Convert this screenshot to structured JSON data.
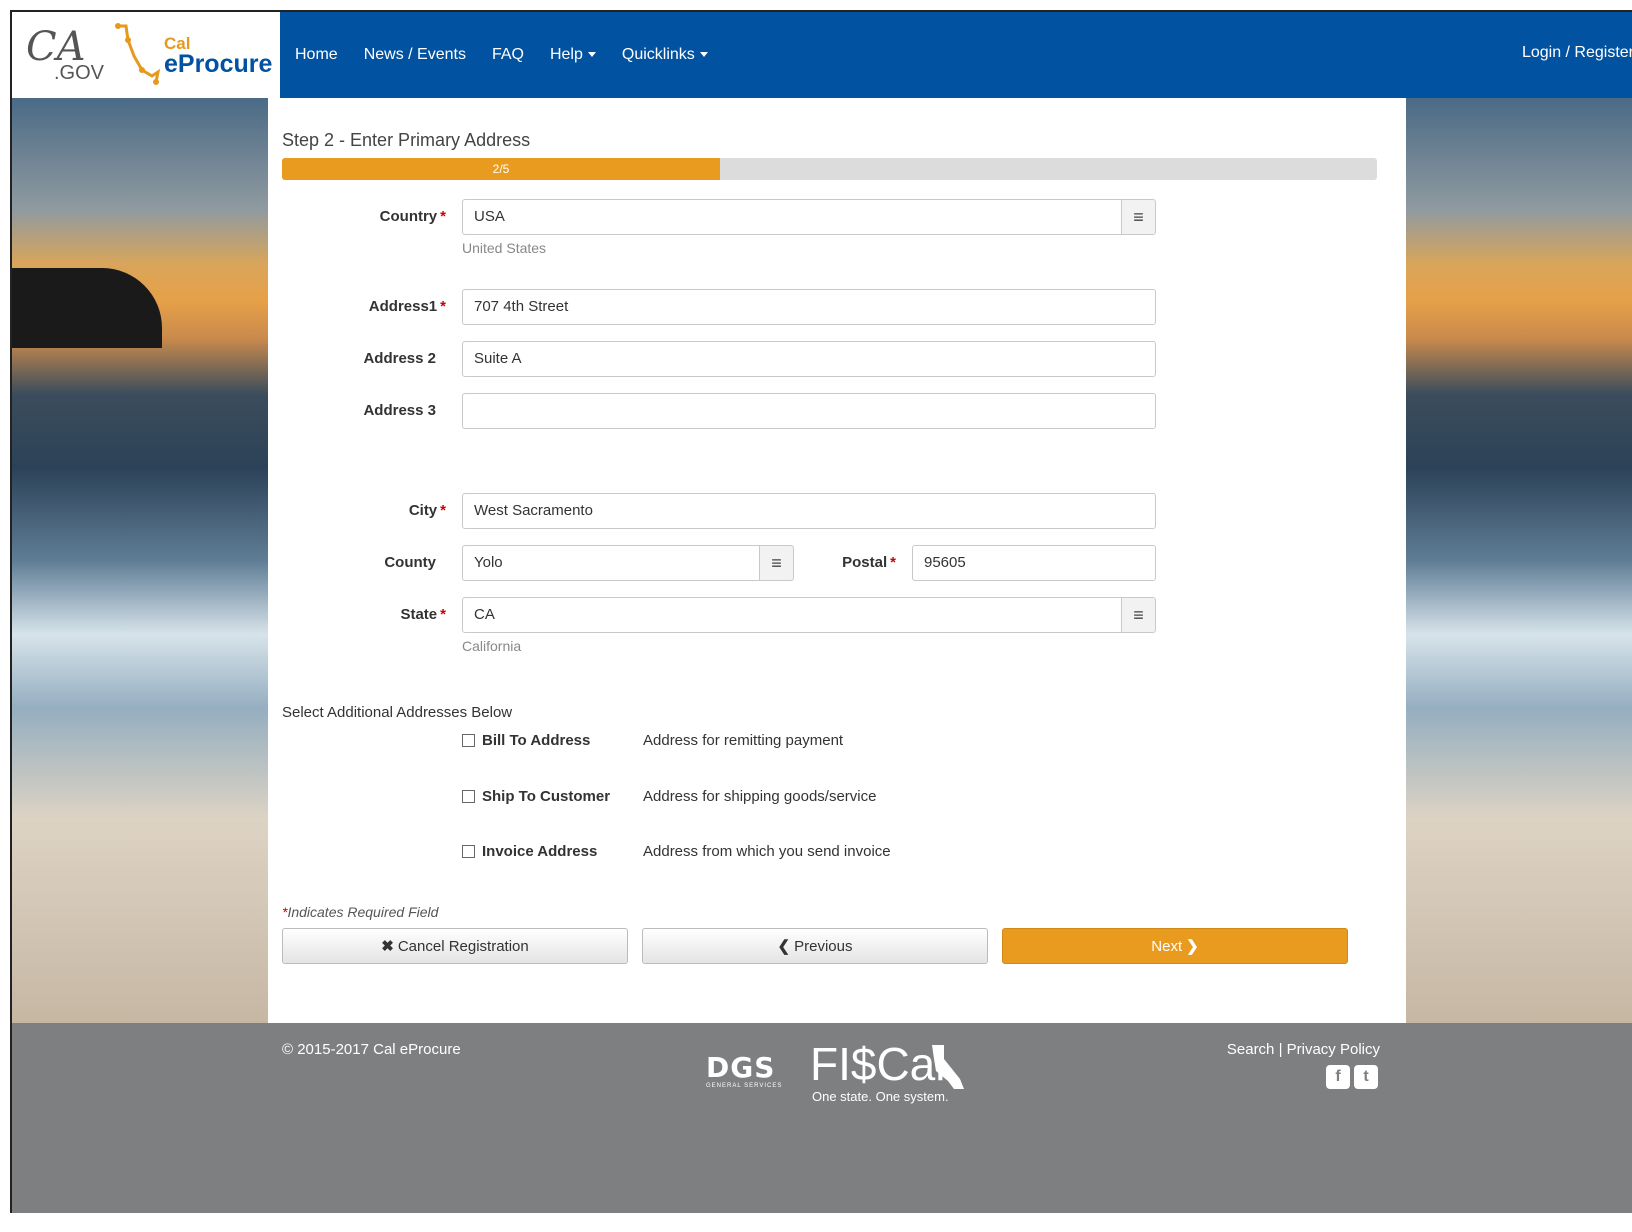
{
  "header": {
    "logo_ca": "CA",
    "logo_gov": ".GOV",
    "logo_cal": "Cal",
    "logo_eprocure": "eProcure",
    "nav": {
      "home": "Home",
      "news": "News / Events",
      "faq": "FAQ",
      "help": "Help",
      "quicklinks": "Quicklinks"
    },
    "login": "Login / Register"
  },
  "form": {
    "step_title": "Step 2 - Enter Primary Address",
    "progress_label": "2/5",
    "progress_fraction": 0.4,
    "country": {
      "label": "Country",
      "value": "USA",
      "hint": "United States"
    },
    "address1": {
      "label": "Address1",
      "value": "707 4th Street"
    },
    "address2": {
      "label": "Address 2",
      "value": "Suite A"
    },
    "address3": {
      "label": "Address 3",
      "value": ""
    },
    "city": {
      "label": "City",
      "value": "West Sacramento"
    },
    "county": {
      "label": "County",
      "value": "Yolo"
    },
    "postal": {
      "label": "Postal",
      "value": "95605"
    },
    "state": {
      "label": "State",
      "value": "CA",
      "hint": "California"
    },
    "required_marker": "*",
    "lookup_icon": "≡",
    "additional_label": "Select Additional Addresses Below",
    "options": [
      {
        "label": "Bill To Address",
        "description": "Address for remitting payment",
        "checked": false
      },
      {
        "label": "Ship To Customer",
        "description": "Address for shipping goods/service",
        "checked": false
      },
      {
        "label": "Invoice Address",
        "description": "Address from which you send invoice",
        "checked": false
      }
    ],
    "required_note": "Indicates Required Field",
    "buttons": {
      "cancel": "Cancel Registration",
      "cancel_icon": "✖",
      "previous": "Previous",
      "previous_icon": "❮",
      "next": "Next",
      "next_icon": "❯"
    }
  },
  "footer": {
    "copyright": "© 2015-2017 Cal eProcure",
    "dgs": "DGS",
    "dgs_sub": "GENERAL SERVICES",
    "fiscal": "FI$Cal",
    "fiscal_tag": "One state. One system.",
    "links": "Search | Privacy Policy",
    "facebook_icon": "f",
    "twitter_icon": "t"
  },
  "colors": {
    "header_blue": "#0152a0",
    "accent_orange": "#e89b1f",
    "footer_gray": "#7e7f80"
  }
}
